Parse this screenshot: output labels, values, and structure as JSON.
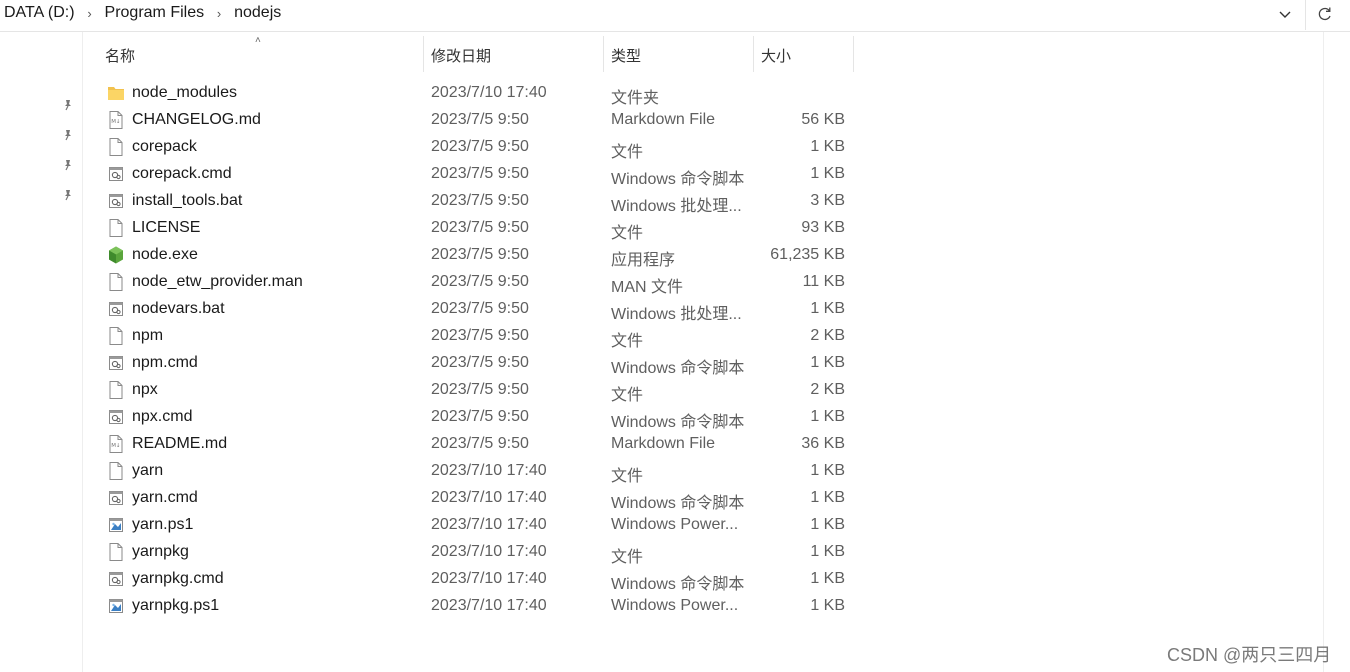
{
  "breadcrumb": [
    "DATA (D:)",
    "Program Files",
    "nodejs"
  ],
  "columns": {
    "name": "名称",
    "date": "修改日期",
    "type": "类型",
    "size": "大小"
  },
  "files": [
    {
      "name": "node_modules",
      "date": "2023/7/10 17:40",
      "type": "文件夹",
      "size": "",
      "icon": "folder"
    },
    {
      "name": "CHANGELOG.md",
      "date": "2023/7/5 9:50",
      "type": "Markdown File",
      "size": "56 KB",
      "icon": "markdown"
    },
    {
      "name": "corepack",
      "date": "2023/7/5 9:50",
      "type": "文件",
      "size": "1 KB",
      "icon": "file"
    },
    {
      "name": "corepack.cmd",
      "date": "2023/7/5 9:50",
      "type": "Windows 命令脚本",
      "size": "1 KB",
      "icon": "script"
    },
    {
      "name": "install_tools.bat",
      "date": "2023/7/5 9:50",
      "type": "Windows 批处理...",
      "size": "3 KB",
      "icon": "script"
    },
    {
      "name": "LICENSE",
      "date": "2023/7/5 9:50",
      "type": "文件",
      "size": "93 KB",
      "icon": "file"
    },
    {
      "name": "node.exe",
      "date": "2023/7/5 9:50",
      "type": "应用程序",
      "size": "61,235 KB",
      "icon": "node"
    },
    {
      "name": "node_etw_provider.man",
      "date": "2023/7/5 9:50",
      "type": "MAN 文件",
      "size": "11 KB",
      "icon": "file"
    },
    {
      "name": "nodevars.bat",
      "date": "2023/7/5 9:50",
      "type": "Windows 批处理...",
      "size": "1 KB",
      "icon": "script"
    },
    {
      "name": "npm",
      "date": "2023/7/5 9:50",
      "type": "文件",
      "size": "2 KB",
      "icon": "file"
    },
    {
      "name": "npm.cmd",
      "date": "2023/7/5 9:50",
      "type": "Windows 命令脚本",
      "size": "1 KB",
      "icon": "script"
    },
    {
      "name": "npx",
      "date": "2023/7/5 9:50",
      "type": "文件",
      "size": "2 KB",
      "icon": "file"
    },
    {
      "name": "npx.cmd",
      "date": "2023/7/5 9:50",
      "type": "Windows 命令脚本",
      "size": "1 KB",
      "icon": "script"
    },
    {
      "name": "README.md",
      "date": "2023/7/5 9:50",
      "type": "Markdown File",
      "size": "36 KB",
      "icon": "markdown"
    },
    {
      "name": "yarn",
      "date": "2023/7/10 17:40",
      "type": "文件",
      "size": "1 KB",
      "icon": "file"
    },
    {
      "name": "yarn.cmd",
      "date": "2023/7/10 17:40",
      "type": "Windows 命令脚本",
      "size": "1 KB",
      "icon": "script"
    },
    {
      "name": "yarn.ps1",
      "date": "2023/7/10 17:40",
      "type": "Windows Power...",
      "size": "1 KB",
      "icon": "powershell"
    },
    {
      "name": "yarnpkg",
      "date": "2023/7/10 17:40",
      "type": "文件",
      "size": "1 KB",
      "icon": "file"
    },
    {
      "name": "yarnpkg.cmd",
      "date": "2023/7/10 17:40",
      "type": "Windows 命令脚本",
      "size": "1 KB",
      "icon": "script"
    },
    {
      "name": "yarnpkg.ps1",
      "date": "2023/7/10 17:40",
      "type": "Windows Power...",
      "size": "1 KB",
      "icon": "powershell"
    }
  ],
  "watermark": "CSDN @两只三四月"
}
